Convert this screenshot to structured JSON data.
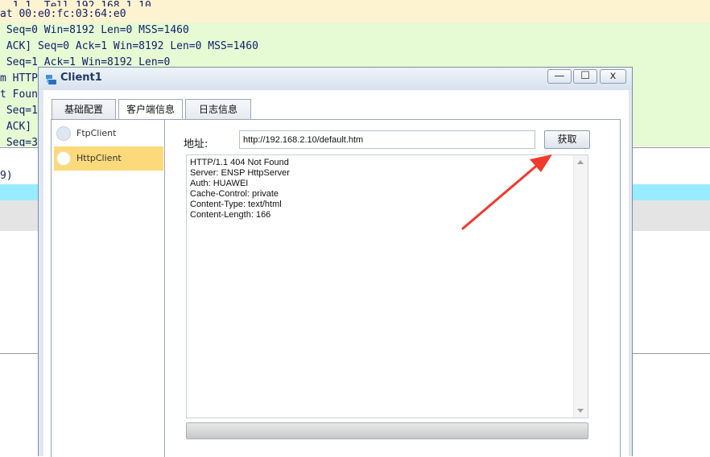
{
  "capture": {
    "rows": [
      {
        "text": "..1.1. Tell 192.168.1.10",
        "color": "yellow"
      },
      {
        "text": "at 00:e0:fc:03:64:e0",
        "color": "yellow"
      },
      {
        "text": " Seq=0 Win=8192 Len=0 MSS=1460",
        "color": "green"
      },
      {
        "text": " ACK] Seq=0 Ack=1 Win=8192 Len=0 MSS=1460",
        "color": "green"
      },
      {
        "text": " Seq=1 Ack=1 Win=8192 Len=0",
        "color": "green"
      },
      {
        "text": "m HTTP",
        "color": "green"
      },
      {
        "text": "t Foun",
        "color": "green"
      },
      {
        "text": " Seq=1",
        "color": "green"
      },
      {
        "text": " ACK]",
        "color": "green"
      },
      {
        "text": " Seq=3",
        "color": "green"
      },
      {
        "text": "9)",
        "color": "white"
      },
      {
        "text": "",
        "color": "cyan"
      },
      {
        "text": "",
        "color": "gray"
      }
    ]
  },
  "window": {
    "title": "Client1",
    "minimize_glyph": "—",
    "maximize_glyph": "☐",
    "close_glyph": "x"
  },
  "tabs": [
    {
      "label": "基础配置"
    },
    {
      "label": "客户端信息"
    },
    {
      "label": "日志信息"
    }
  ],
  "client_list": [
    {
      "label": "FtpClient"
    },
    {
      "label": "HttpClient"
    }
  ],
  "http": {
    "address_label": "地址:",
    "address_value": "http://192.168.2.10/default.htm",
    "fetch_label": "获取",
    "response_lines": [
      "HTTP/1.1 404 Not Found",
      "Server: ENSP HttpServer",
      "Auth: HUAWEI",
      "Cache-Control: private",
      "Content-Type: text/html",
      "Content-Length: 166"
    ]
  },
  "annotation_color": "#f03a2c"
}
